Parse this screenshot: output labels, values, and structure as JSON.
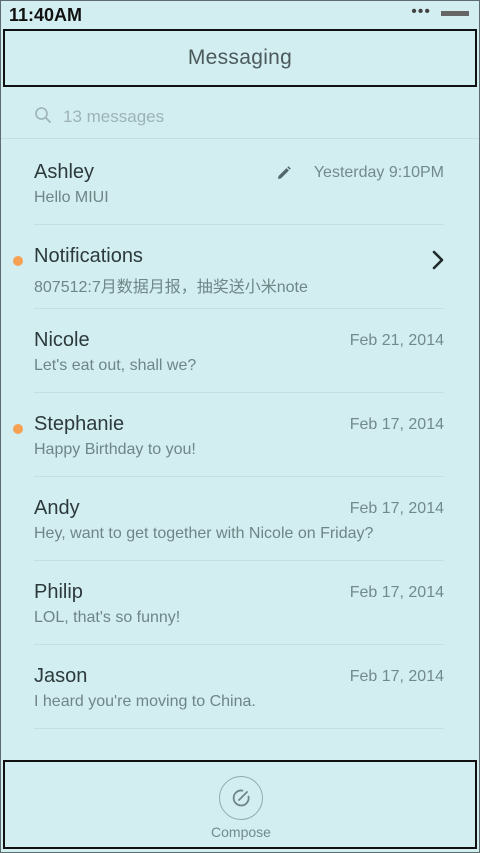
{
  "status_bar": {
    "time": "11:40AM",
    "dots": "•••"
  },
  "header": {
    "title": "Messaging"
  },
  "search": {
    "placeholder": "13 messages"
  },
  "conversations": [
    {
      "name": "Ashley",
      "preview": "Hello MIUI",
      "time": "Yesterday 9:10PM",
      "unread": false,
      "draft": true
    },
    {
      "name": "Notifications",
      "preview": "807512:7月数据月报，抽奖送小米note",
      "time": "",
      "unread": true,
      "chevron": true
    },
    {
      "name": "Nicole",
      "preview": "Let's eat out, shall we?",
      "time": "Feb 21, 2014",
      "unread": false
    },
    {
      "name": "Stephanie",
      "preview": "Happy Birthday to you!",
      "time": "Feb 17, 2014",
      "unread": true
    },
    {
      "name": "Andy",
      "preview": "Hey, want to get together with Nicole on Friday?",
      "time": "Feb 17, 2014",
      "unread": false
    },
    {
      "name": "Philip",
      "preview": "LOL, that's so funny!",
      "time": "Feb 17, 2014",
      "unread": false
    },
    {
      "name": "Jason",
      "preview": "I heard you're moving to China.",
      "time": "Feb 17, 2014",
      "unread": false
    }
  ],
  "footer": {
    "compose_label": "Compose"
  },
  "colors": {
    "background": "#d2eef0",
    "unread_dot": "#f5a052",
    "title": "#4c5a5c"
  }
}
